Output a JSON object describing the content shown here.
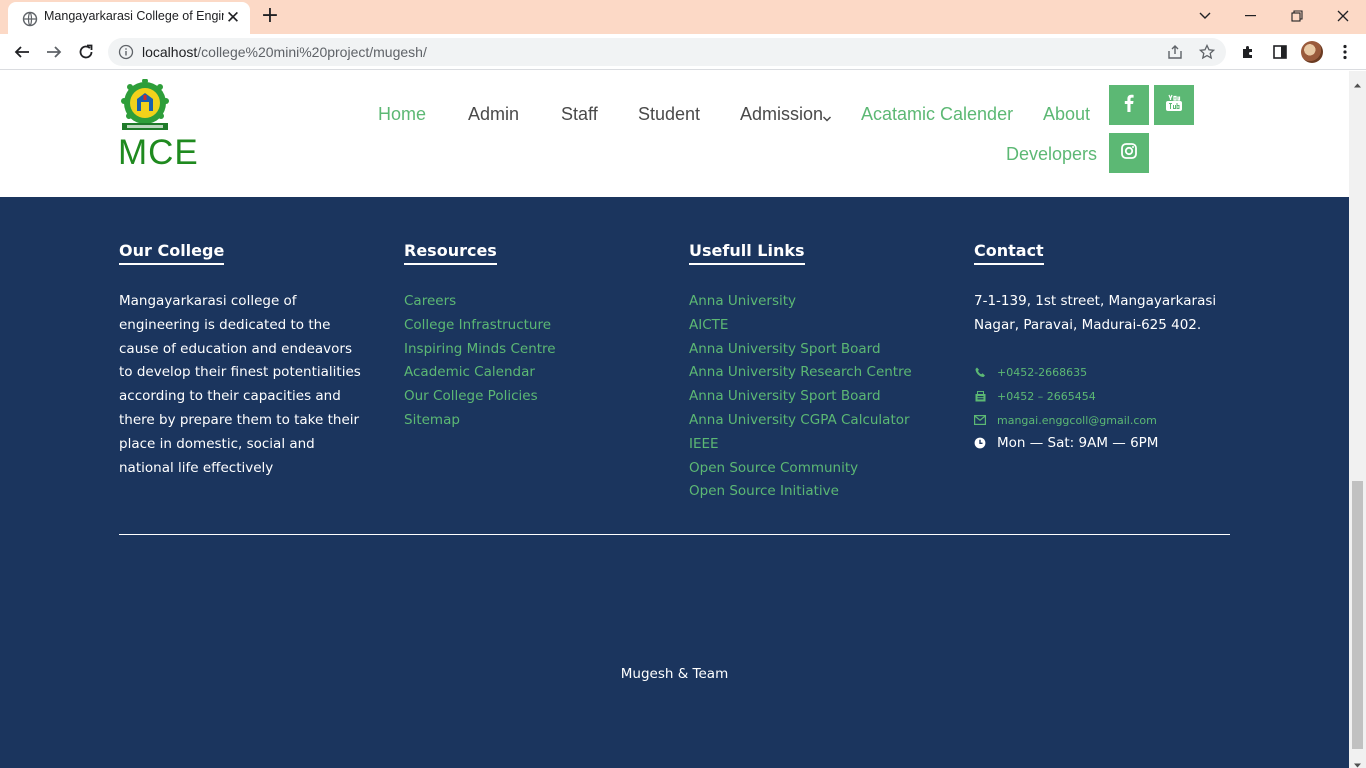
{
  "browser": {
    "tab_title": "Mangayarkarasi College of Engineering",
    "tab_close": "✕",
    "new_tab": "+",
    "url_host": "localhost",
    "url_path": "/college%20mini%20project/mugesh/"
  },
  "header": {
    "logo_text": "MCE",
    "nav": [
      {
        "label": "Home",
        "active": true
      },
      {
        "label": "Admin"
      },
      {
        "label": "Staff"
      },
      {
        "label": "Student"
      },
      {
        "label": "Admission",
        "has_dropdown": true
      },
      {
        "label": "Acatamic Calender"
      },
      {
        "label": "About"
      },
      {
        "label": "Developers"
      }
    ],
    "social": [
      "facebook-icon",
      "youtube-icon",
      "instagram-icon"
    ],
    "accent_color": "#5cb874"
  },
  "footer": {
    "background": "#1b355e",
    "our_college": {
      "heading": "Our College",
      "text": "Mangayarkarasi college of engineering is dedicated to the cause of education and endeavors to develop their finest potentialities according to their capacities and there by prepare them to take their place in domestic, social and national life effectively"
    },
    "resources": {
      "heading": "Resources",
      "links": [
        "Careers",
        "College Infrastructure",
        "Inspiring Minds Centre",
        "Academic Calendar",
        "Our College Policies",
        "Sitemap"
      ]
    },
    "useful_links": {
      "heading": "Usefull Links",
      "links": [
        "Anna University",
        "AICTE",
        "Anna University Sport Board",
        "Anna University Research Centre",
        "Anna University Sport Board",
        "Anna University CGPA Calculator",
        "IEEE",
        "Open Source Community",
        "Open Source Initiative"
      ]
    },
    "contact": {
      "heading": "Contact",
      "address": "7-1-139, 1st street, Mangayarkarasi Nagar, Paravai, Madurai-625 402.",
      "phone": "+0452-2668635",
      "fax": "+0452 – 2665454",
      "email": "mangai.enggcoll@gmail.com",
      "hours": "Mon — Sat: 9AM — 6PM"
    },
    "credit": "Mugesh & Team"
  }
}
